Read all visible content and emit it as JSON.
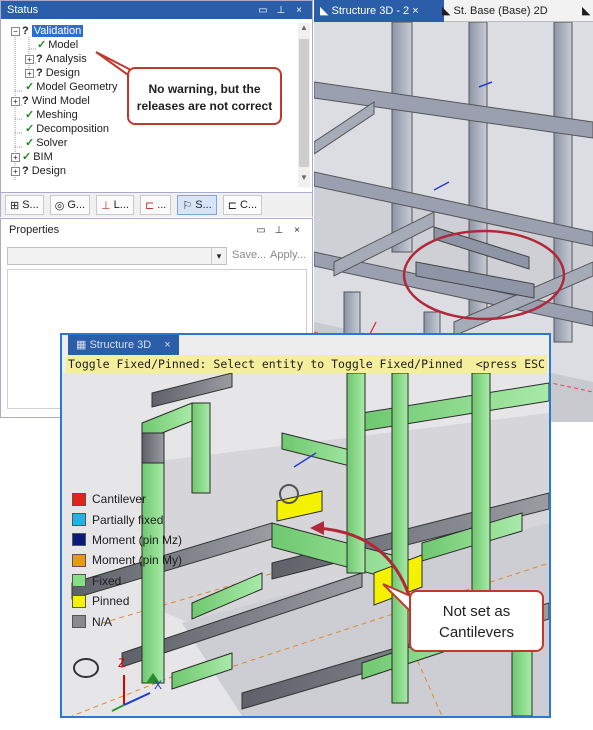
{
  "status_panel": {
    "title": "Status",
    "items": [
      {
        "label": "Validation",
        "icon": "question-icon",
        "selected": true
      },
      {
        "label": "Model",
        "icon": "check-icon"
      },
      {
        "label": "Analysis",
        "icon": "question-icon"
      },
      {
        "label": "Design",
        "icon": "question-icon"
      },
      {
        "label": "Model Geometry",
        "icon": "check-icon"
      },
      {
        "label": "Wind Model",
        "icon": "question-icon"
      },
      {
        "label": "Meshing",
        "icon": "check-icon"
      },
      {
        "label": "Decomposition",
        "icon": "check-icon"
      },
      {
        "label": "Solver",
        "icon": "check-icon"
      },
      {
        "label": "BIM",
        "icon": "check-icon"
      },
      {
        "label": "Design",
        "icon": "question-icon"
      }
    ]
  },
  "callout_top": {
    "line1": "No  warning, but the",
    "line2": "releases are not correct"
  },
  "bottom_tabs": [
    "S...",
    "G...",
    "L...",
    "...",
    "S...",
    "C..."
  ],
  "properties": {
    "title": "Properties",
    "save": "Save...",
    "apply": "Apply..."
  },
  "view_tabs": [
    "Structure 3D - 2",
    "St. Base (Base) 2D"
  ],
  "inner_window": {
    "tab": "Structure 3D",
    "message": "Toggle Fixed/Pinned: Select entity to Toggle Fixed/Pinned",
    "esc": "<press ESC",
    "axis_labels": {
      "z": "Z",
      "x": "X"
    }
  },
  "legend": [
    {
      "label": "Cantilever",
      "color": "#e2231a"
    },
    {
      "label": "Partially fixed",
      "color": "#1fb3e8"
    },
    {
      "label": "Moment (pin Mz)",
      "color": "#0b1a7a"
    },
    {
      "label": "Moment (pin My)",
      "color": "#e59a0f"
    },
    {
      "label": "Fixed",
      "color": "#86de86"
    },
    {
      "label": "Pinned",
      "color": "#f4f200"
    },
    {
      "label": "N/A",
      "color": "#8a8a8a"
    }
  ],
  "callout_bottom": {
    "line1": "Not set as",
    "line2": "Cantilevers"
  },
  "colors": {
    "accent": "#2a5ea8",
    "callout_border": "#c0392b",
    "message_bg": "#f5ee9e"
  }
}
